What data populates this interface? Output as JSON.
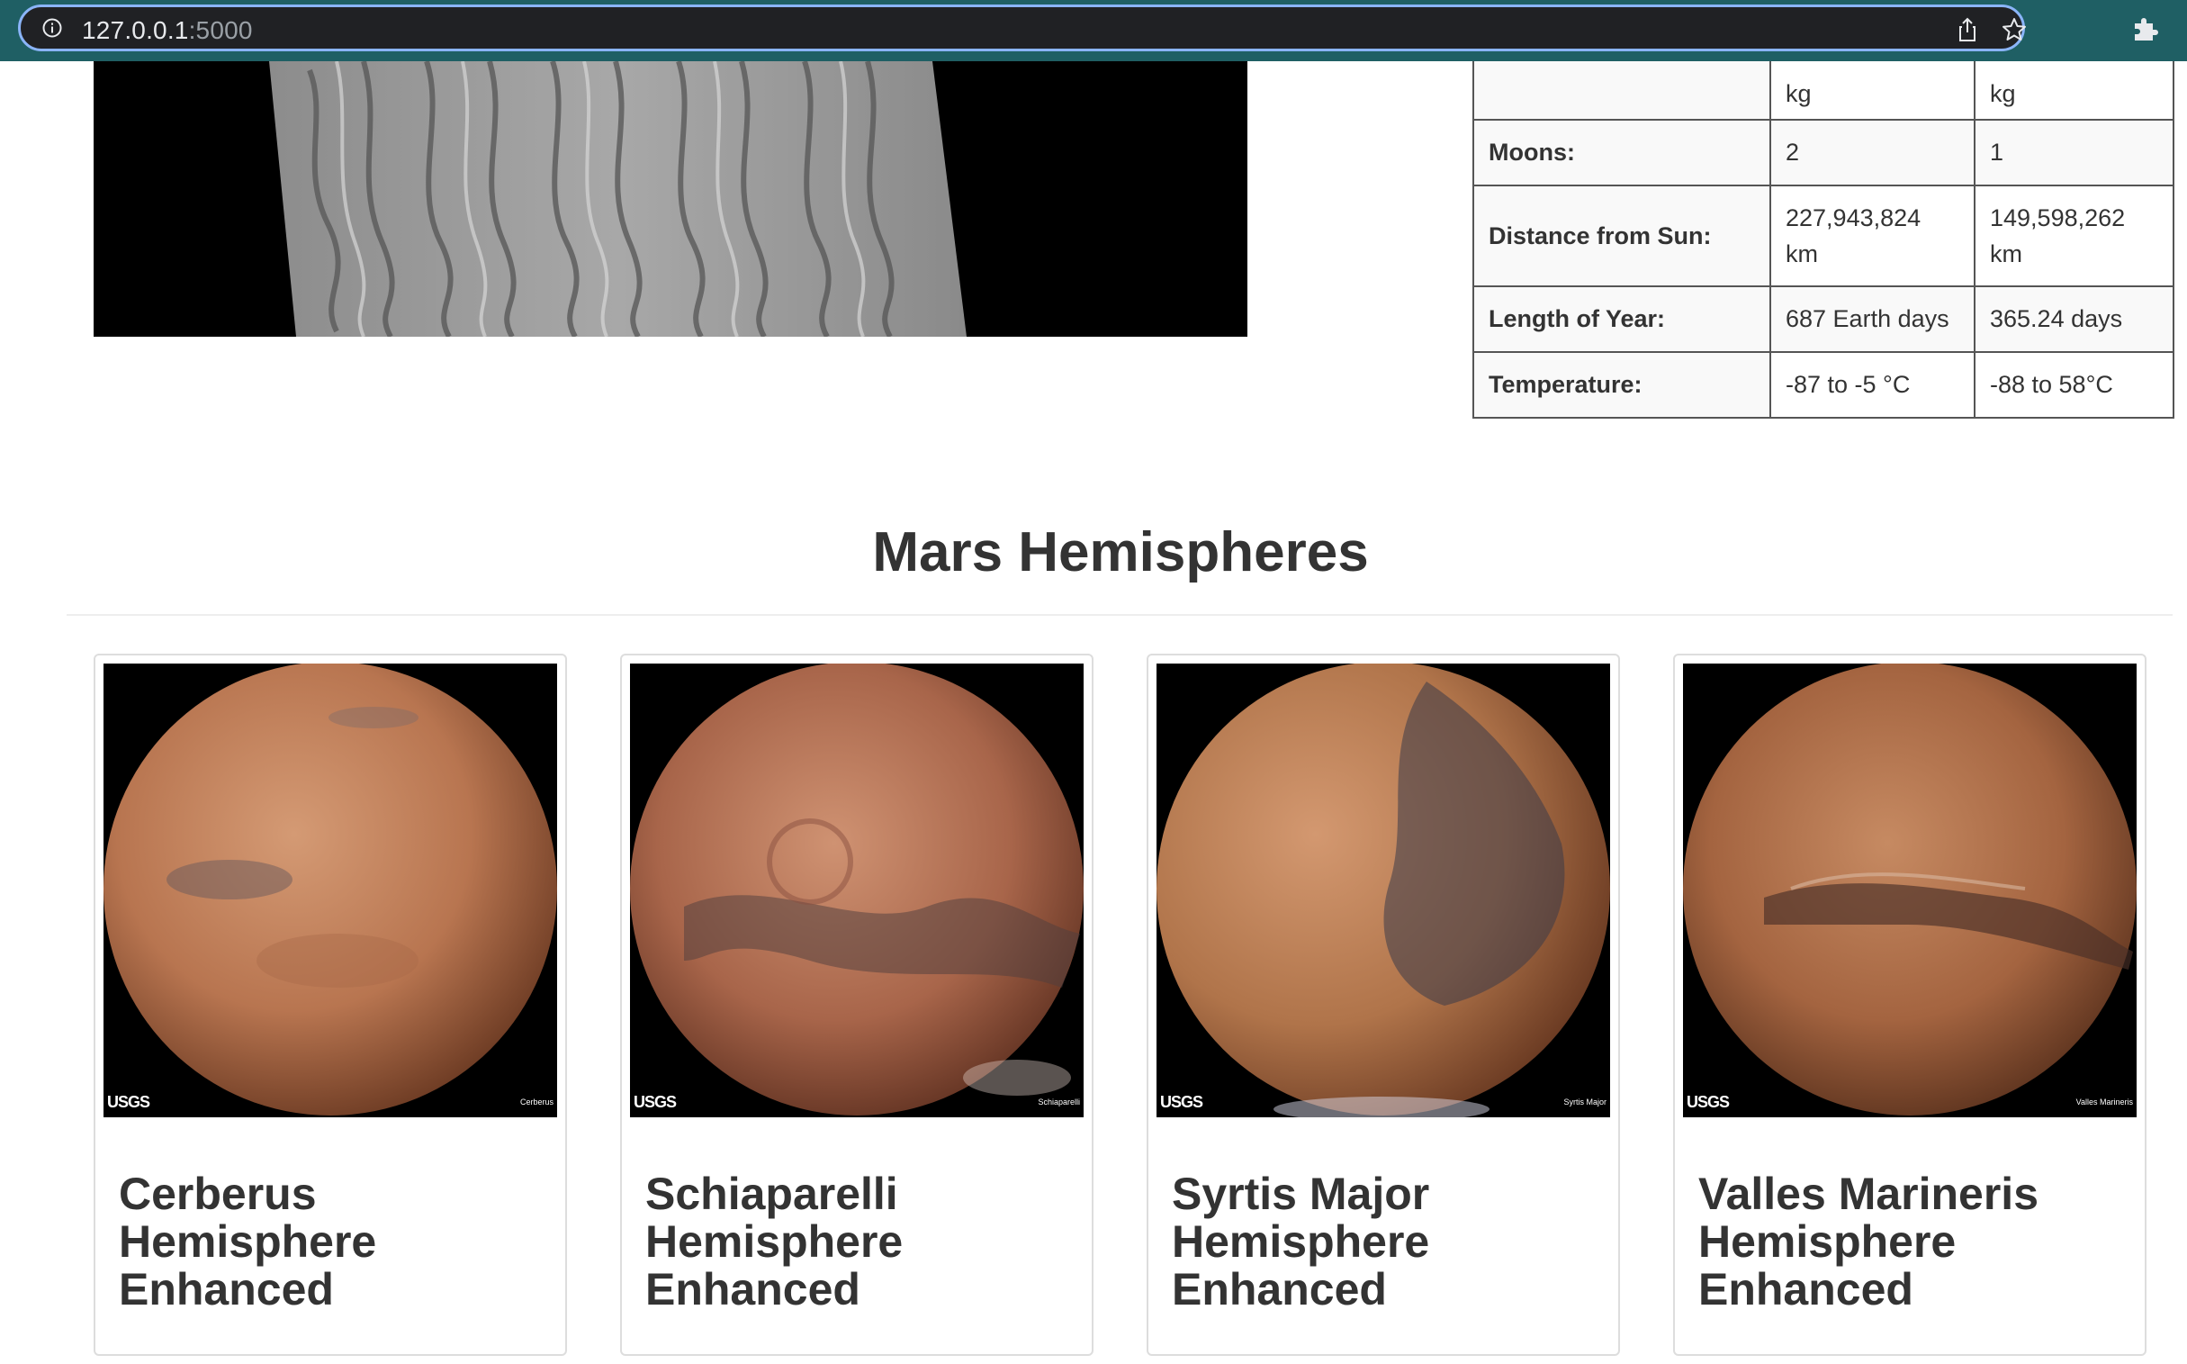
{
  "browser": {
    "url_host": "127.0.0.1",
    "url_port": ":5000"
  },
  "facts_table": {
    "rows": [
      {
        "label": "",
        "mars": "kg",
        "earth": "kg"
      },
      {
        "label": "Moons:",
        "mars": "2",
        "earth": "1"
      },
      {
        "label": "Distance from Sun:",
        "mars": "227,943,824 km",
        "earth": "149,598,262 km"
      },
      {
        "label": "Length of Year:",
        "mars": "687 Earth days",
        "earth": "365.24 days"
      },
      {
        "label": "Temperature:",
        "mars": "-87 to -5 °C",
        "earth": "-88 to 58°C"
      }
    ]
  },
  "hemispheres": {
    "title": "Mars Hemispheres",
    "cards": [
      {
        "title": "Cerberus Hemisphere Enhanced",
        "logo": "USGS",
        "tag": "Cerberus"
      },
      {
        "title": "Schiaparelli Hemisphere Enhanced",
        "logo": "USGS",
        "tag": "Schiaparelli"
      },
      {
        "title": "Syrtis Major Hemisphere Enhanced",
        "logo": "USGS",
        "tag": "Syrtis Major"
      },
      {
        "title": "Valles Marineris Hemisphere Enhanced",
        "logo": "USGS",
        "tag": "Valles Marineris"
      }
    ]
  }
}
